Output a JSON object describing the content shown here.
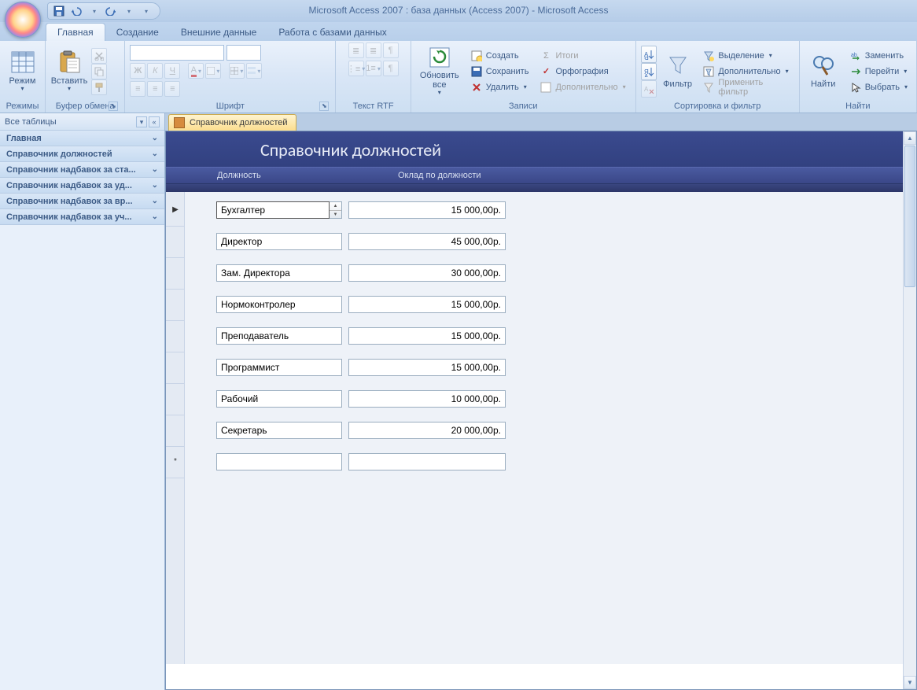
{
  "title": "Microsoft Access 2007 : база данных (Access 2007)  -  Microsoft Access",
  "tabs": {
    "home": "Главная",
    "create": "Создание",
    "external": "Внешние данные",
    "dbtools": "Работа с базами данных"
  },
  "ribbon": {
    "modes": {
      "label": "Режимы",
      "view": "Режим"
    },
    "clipboard": {
      "label": "Буфер обмена",
      "paste": "Вставить"
    },
    "font": {
      "label": "Шрифт"
    },
    "rtf": {
      "label": "Текст RTF"
    },
    "records": {
      "label": "Записи",
      "refresh": "Обновить все",
      "new": "Создать",
      "save": "Сохранить",
      "delete": "Удалить",
      "totals": "Итоги",
      "spelling": "Орфография",
      "more": "Дополнительно"
    },
    "sortfilter": {
      "label": "Сортировка и фильтр",
      "filter": "Фильтр",
      "selection": "Выделение",
      "advanced": "Дополнительно",
      "toggle": "Применить фильтр"
    },
    "find": {
      "label": "Найти",
      "find": "Найти",
      "replace": "Заменить",
      "goto": "Перейти",
      "select": "Выбрать"
    }
  },
  "nav": {
    "header": "Все таблицы",
    "items": [
      "Главная",
      "Справочник должностей",
      "Справочник надбавок за ста...",
      "Справочник надбавок за уд...",
      "Справочник надбавок за вр...",
      "Справочник надбавок за уч..."
    ]
  },
  "doc": {
    "tab": "Справочник должностей",
    "title": "Справочник должностей",
    "col1": "Должность",
    "col2": "Оклад по должности",
    "rows": [
      {
        "pos": "Бухгалтер",
        "salary": "15 000,00р."
      },
      {
        "pos": "Директор",
        "salary": "45 000,00р."
      },
      {
        "pos": "Зам. Директора",
        "salary": "30 000,00р."
      },
      {
        "pos": "Нормоконтролер",
        "salary": "15 000,00р."
      },
      {
        "pos": "Преподаватель",
        "salary": "15 000,00р."
      },
      {
        "pos": "Программист",
        "salary": "15 000,00р."
      },
      {
        "pos": "Рабочий",
        "salary": "10 000,00р."
      },
      {
        "pos": "Секретарь",
        "salary": "20 000,00р."
      }
    ]
  }
}
